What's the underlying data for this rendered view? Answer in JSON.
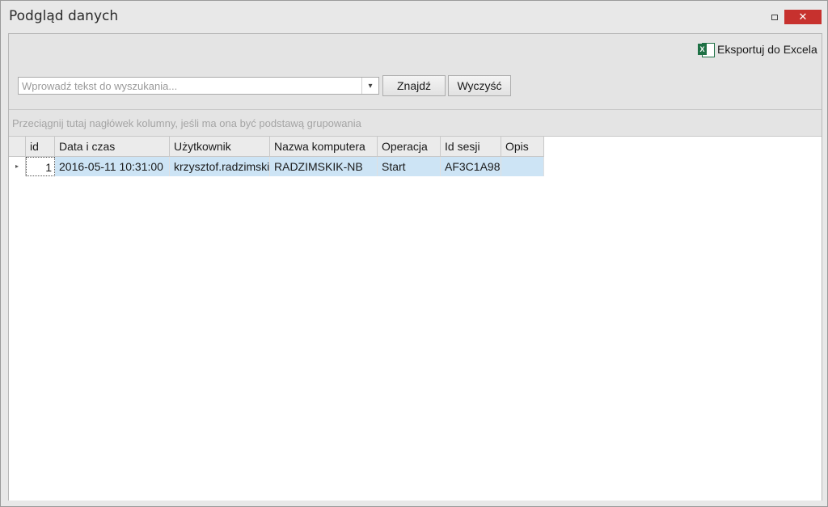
{
  "window": {
    "title": "Podgląd danych",
    "minimize_glyph": "▫",
    "close_glyph": "✕"
  },
  "toolbar": {
    "export_label": "Eksportuj do Excela",
    "export_icon": "excel-icon",
    "excel_icon_glyph": "X"
  },
  "search": {
    "placeholder": "Wprowadź tekst do wyszukania...",
    "value": "",
    "dropdown_glyph": "▾",
    "find_label": "Znajdź",
    "clear_label": "Wyczyść"
  },
  "grid": {
    "group_hint": "Przeciągnij tutaj nagłówek kolumny, jeśli ma ona być podstawą grupowania",
    "columns": [
      "id",
      "Data i czas",
      "Użytkownik",
      "Nazwa komputera",
      "Operacja",
      "Id sesji",
      "Opis"
    ],
    "rows": [
      {
        "indicator": "▸",
        "cells": [
          "1",
          "2016-05-11 10:31:00",
          "krzysztof.radzimski",
          "RADZIMSKIK-NB",
          "Start",
          "AF3C1A98",
          ""
        ]
      }
    ]
  },
  "colors": {
    "selected_row": "#cde4f5",
    "close_button": "#c7312e",
    "excel_green": "#1e7145"
  }
}
